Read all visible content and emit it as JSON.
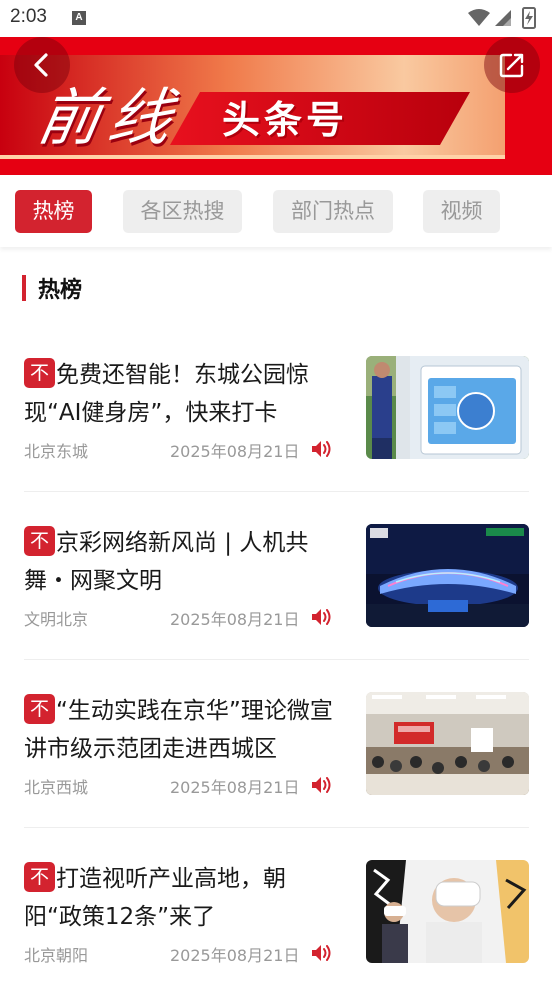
{
  "status_bar": {
    "time": "2:03",
    "notification_icon": "A",
    "icons": [
      "wifi-icon",
      "signal-icon",
      "battery-charging-icon"
    ]
  },
  "header": {
    "logo_text": "前线",
    "title": "头条号",
    "back_icon": "chevron-left-icon",
    "share_icon": "share-external-icon",
    "colors": {
      "brand_red": "#e60012",
      "accent": "#d3232f"
    }
  },
  "tabs": [
    {
      "label": "热榜",
      "active": true
    },
    {
      "label": "各区热搜",
      "active": false
    },
    {
      "label": "部门热点",
      "active": false
    },
    {
      "label": "视频",
      "active": false
    }
  ],
  "section": {
    "title": "热榜"
  },
  "news": [
    {
      "tag": "不",
      "title": "免费还智能！东城公园惊现“AI健身房”，快来打卡",
      "source": "北京东城",
      "date": "2025年08月21日",
      "image": "AI fitness kiosk in park"
    },
    {
      "tag": "不",
      "title": "京彩网络新风尚 | 人机共舞・网聚文明",
      "source": "文明北京",
      "date": "2025年08月21日",
      "image": "stadium lit at night, CCTV broadcast"
    },
    {
      "tag": "不",
      "title": "“生动实践在京华”理论微宣讲市级示范团走进西城区",
      "source": "北京西城",
      "date": "2025年08月21日",
      "image": "meeting room audience and presenter"
    },
    {
      "tag": "不",
      "title": "打造视听产业高地，朝阳“政策12条”来了",
      "source": "北京朝阳",
      "date": "2025年08月21日",
      "image": "people wearing VR headsets"
    }
  ]
}
